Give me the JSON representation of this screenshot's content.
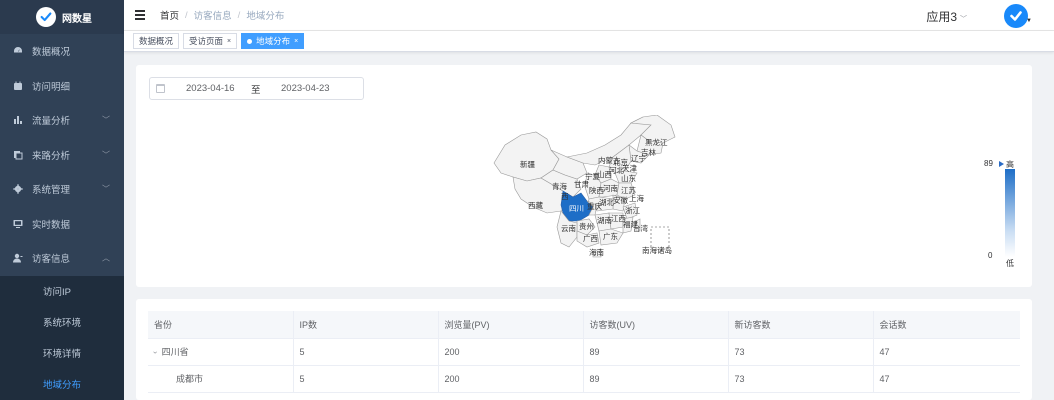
{
  "app": {
    "logo_text": "网数星"
  },
  "sidebar": {
    "items": [
      {
        "label": "数据概况",
        "icon": "dashboard-icon",
        "has_children": false
      },
      {
        "label": "访问明细",
        "icon": "calendar-icon",
        "has_children": false
      },
      {
        "label": "流量分析",
        "icon": "bar-chart-icon",
        "has_children": true,
        "chevron": "﹀"
      },
      {
        "label": "来路分析",
        "icon": "copy-icon",
        "has_children": true,
        "chevron": "﹀"
      },
      {
        "label": "系统管理",
        "icon": "gear-icon",
        "has_children": true,
        "chevron": "﹀"
      },
      {
        "label": "实时数据",
        "icon": "monitor-icon",
        "has_children": false
      },
      {
        "label": "访客信息",
        "icon": "user-icon",
        "has_children": true,
        "chevron": "︿",
        "expanded": true
      }
    ],
    "submenu": [
      {
        "label": "访问IP",
        "active": false
      },
      {
        "label": "系统环境",
        "active": false
      },
      {
        "label": "环境详情",
        "active": false
      },
      {
        "label": "地域分布",
        "active": true
      }
    ]
  },
  "header": {
    "breadcrumb": [
      "首页",
      "访客信息",
      "地域分布"
    ],
    "breadcrumb_sep": "/",
    "app_selector": "应用3",
    "app_selector_chevron": "﹀",
    "avatar_caret": "▼"
  },
  "tags": [
    {
      "label": "数据概况",
      "active": false,
      "closable": false
    },
    {
      "label": "受访页面",
      "active": false,
      "closable": true
    },
    {
      "label": "地域分布",
      "active": true,
      "closable": true
    }
  ],
  "tag_close_glyph": "×",
  "date_range": {
    "start": "2023-04-16",
    "separator": "至",
    "end": "2023-04-23"
  },
  "map": {
    "labels": [
      "新疆",
      "西藏",
      "青海",
      "甘肃",
      "内蒙古",
      "黑龙江",
      "吉林",
      "辽宁",
      "北京",
      "天津",
      "河北",
      "山西",
      "山东",
      "宁夏",
      "陕西",
      "河南",
      "江苏",
      "安徽",
      "上海",
      "湖北",
      "浙江",
      "四川",
      "重庆",
      "湖南",
      "江西",
      "福建",
      "贵州",
      "云南",
      "广西",
      "广东",
      "台湾",
      "海南",
      "南海诸岛",
      "西"
    ],
    "highlight_province": "四川",
    "highlight_color": "#1e6ec7",
    "base_color": "#f3f3f3",
    "visual_map": {
      "max": "89",
      "min": "0",
      "high_label": "高",
      "low_label": "低"
    }
  },
  "table": {
    "columns": [
      "省份",
      "IP数",
      "浏览量(PV)",
      "访客数(UV)",
      "新访客数",
      "会话数"
    ],
    "rows": [
      {
        "cells": [
          "四川省",
          "5",
          "200",
          "89",
          "73",
          "47"
        ],
        "expandable": true,
        "expand_glyph": "›"
      },
      {
        "cells": [
          "成都市",
          "5",
          "200",
          "89",
          "73",
          "47"
        ],
        "expandable": false
      }
    ]
  }
}
